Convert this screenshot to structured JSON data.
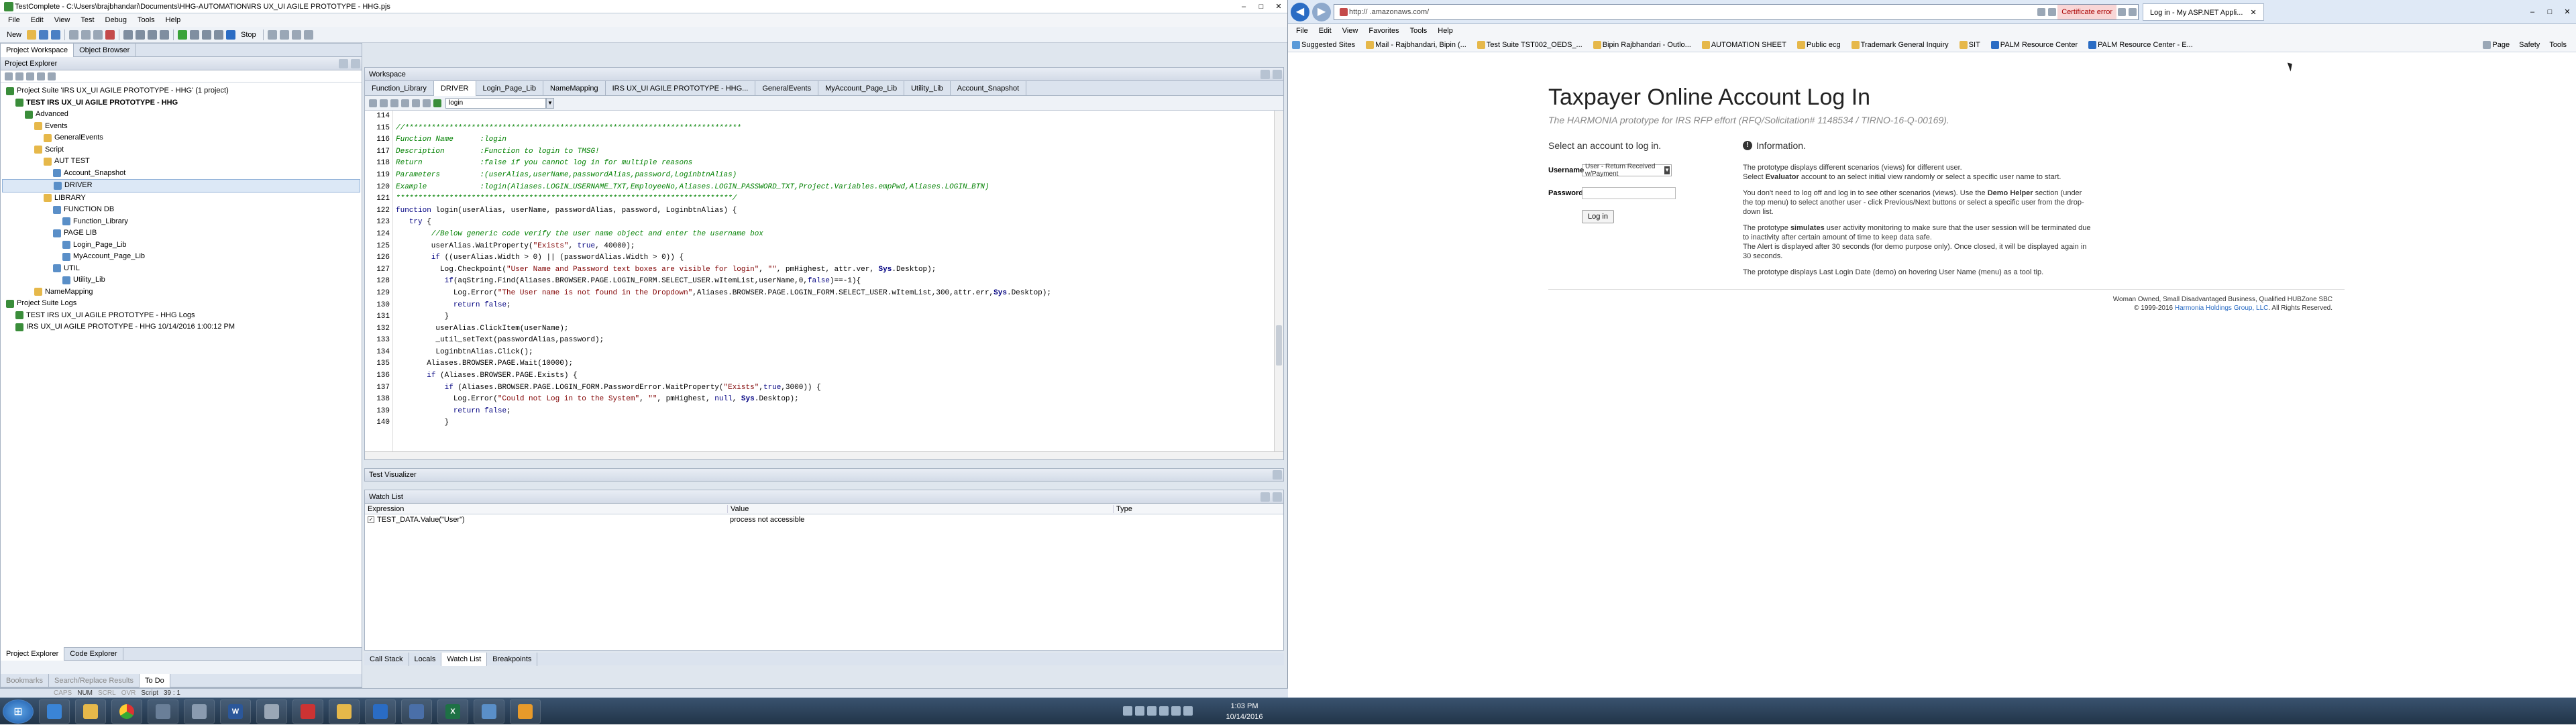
{
  "testcomplete": {
    "title": "TestComplete - C:\\Users\\brajbhandari\\Documents\\HHG-AUTOMATION\\IRS UX_UI AGILE PROTOTYPE - HHG.pjs",
    "menu": [
      "File",
      "Edit",
      "View",
      "Test",
      "Debug",
      "Tools",
      "Help"
    ],
    "toolbar_new": "New",
    "toolbar_stop": "Stop",
    "project_tabs": [
      "Project Workspace",
      "Object Browser"
    ],
    "project_explorer_title": "Project Explorer",
    "tree": [
      {
        "label": "Project Suite 'IRS UX_UI AGILE PROTOTYPE - HHG' (1 project)",
        "indent": 0,
        "bold": false
      },
      {
        "label": "TEST IRS UX_UI AGILE PROTOTYPE - HHG",
        "indent": 1,
        "bold": true
      },
      {
        "label": "Advanced",
        "indent": 2,
        "bold": false
      },
      {
        "label": "Events",
        "indent": 3,
        "bold": false
      },
      {
        "label": "GeneralEvents",
        "indent": 4,
        "bold": false
      },
      {
        "label": "Script",
        "indent": 3,
        "bold": false
      },
      {
        "label": "AUT TEST",
        "indent": 4,
        "bold": false
      },
      {
        "label": "Account_Snapshot",
        "indent": 5,
        "bold": false
      },
      {
        "label": "DRIVER",
        "indent": 5,
        "bold": false,
        "selected": true
      },
      {
        "label": "LIBRARY",
        "indent": 4,
        "bold": false
      },
      {
        "label": "FUNCTION DB",
        "indent": 5,
        "bold": false
      },
      {
        "label": "Function_Library",
        "indent": 6,
        "bold": false
      },
      {
        "label": "PAGE LIB",
        "indent": 5,
        "bold": false
      },
      {
        "label": "Login_Page_Lib",
        "indent": 6,
        "bold": false
      },
      {
        "label": "MyAccount_Page_Lib",
        "indent": 6,
        "bold": false
      },
      {
        "label": "UTIL",
        "indent": 5,
        "bold": false
      },
      {
        "label": "Utility_Lib",
        "indent": 6,
        "bold": false
      },
      {
        "label": "NameMapping",
        "indent": 3,
        "bold": false
      },
      {
        "label": "Project Suite Logs",
        "indent": 0,
        "bold": false
      },
      {
        "label": "TEST IRS UX_UI AGILE PROTOTYPE - HHG Logs",
        "indent": 1,
        "bold": false
      },
      {
        "label": "IRS UX_UI AGILE PROTOTYPE - HHG 10/14/2016 1:00:12 PM",
        "indent": 1,
        "bold": false
      }
    ],
    "project_bottom_tabs": [
      "Project Explorer",
      "Code Explorer"
    ],
    "todo_tabs": [
      "Bookmarks",
      "Search/Replace Results",
      "To Do"
    ],
    "workspace_title": "Workspace",
    "doc_tabs": [
      "Function_Library",
      "DRIVER",
      "Login_Page_Lib",
      "NameMapping",
      "IRS UX_UI AGILE PROTOTYPE - HHG...",
      "GeneralEvents",
      "MyAccount_Page_Lib",
      "Utility_Lib",
      "Account_Snapshot"
    ],
    "active_doc_tab": "DRIVER",
    "routine_selector": "login",
    "code_lines": [
      {
        "n": "114",
        "html": ""
      },
      {
        "n": "115",
        "html": "<span class='c'>//****************************************************************************</span>"
      },
      {
        "n": "116",
        "html": "<span class='c'>Function Name      :login</span>"
      },
      {
        "n": "117",
        "html": "<span class='c'>Description        :Function to login to TMSG!</span>"
      },
      {
        "n": "118",
        "html": "<span class='c'>Return             :false if you cannot log in for multiple reasons</span>"
      },
      {
        "n": "119",
        "html": "<span class='c'>Parameters         :(userAlias,userName,passwordAlias,password,LoginbtnAlias)</span>"
      },
      {
        "n": "120",
        "html": "<span class='c'>Example            :login(Aliases.LOGIN_USERNAME_TXT,EmployeeNo,Aliases.LOGIN_PASSWORD_TXT,Project.Variables.empPwd,Aliases.LOGIN_BTN)</span>"
      },
      {
        "n": "121",
        "html": "<span class='c'>****************************************************************************/</span>"
      },
      {
        "n": "122",
        "html": "<span class='k'>function</span> login(userAlias, userName, passwordAlias, password, LoginbtnAlias) {"
      },
      {
        "n": "123",
        "html": "   <span class='k'>try</span> {"
      },
      {
        "n": "124",
        "html": "        <span class='c'>//Below generic code verify the user name object and enter the username box</span>"
      },
      {
        "n": "125",
        "html": "        userAlias.WaitProperty(<span class='s'>\"Exists\"</span>, <span class='k'>true</span>, 40000);"
      },
      {
        "n": "126",
        "html": "        <span class='k'>if</span> ((userAlias.Width > 0) || (passwordAlias.Width > 0)) {"
      },
      {
        "n": "127",
        "html": "          Log.Checkpoint(<span class='s'>\"User Name and Password text boxes are visible for login\"</span>, <span class='s'>\"\"</span>, pmHighest, attr.ver, <span class='b'>Sys</span>.Desktop);"
      },
      {
        "n": "128",
        "html": "           <span class='k'>if</span>(aqString.Find(Aliases.BROWSER.PAGE.LOGIN_FORM.SELECT_USER.wItemList,userName,0,<span class='k'>false</span>)==-1){"
      },
      {
        "n": "129",
        "html": "             Log.Error(<span class='s'>\"The User name is not found in the Dropdown\"</span>,Aliases.BROWSER.PAGE.LOGIN_FORM.SELECT_USER.wItemList,300,attr.err,<span class='b'>Sys</span>.Desktop);"
      },
      {
        "n": "130",
        "html": "             <span class='k'>return false</span>;"
      },
      {
        "n": "131",
        "html": "           }"
      },
      {
        "n": "132",
        "html": "         userAlias.ClickItem(userName);"
      },
      {
        "n": "133",
        "html": "         _util_setText(passwordAlias,password);"
      },
      {
        "n": "134",
        "html": "         LoginbtnAlias.Click();"
      },
      {
        "n": "135",
        "html": "       Aliases.BROWSER.PAGE.Wait(10000);"
      },
      {
        "n": "136",
        "html": "       <span class='k'>if</span> (Aliases.BROWSER.PAGE.Exists) {"
      },
      {
        "n": "137",
        "html": "           <span class='k'>if</span> (Aliases.BROWSER.PAGE.LOGIN_FORM.PasswordError.WaitProperty(<span class='s'>\"Exists\"</span>,<span class='k'>true</span>,3000)) {"
      },
      {
        "n": "138",
        "html": "             Log.Error(<span class='s'>\"Could not Log in to the System\"</span>, <span class='s'>\"\"</span>, pmHighest, <span class='k'>null</span>, <span class='b'>Sys</span>.Desktop);"
      },
      {
        "n": "139",
        "html": "             <span class='k'>return false</span>;"
      },
      {
        "n": "140",
        "html": "           }"
      }
    ],
    "test_visualizer": "Test Visualizer",
    "watch_title": "Watch List",
    "watch_cols": [
      "Expression",
      "Value",
      "Type"
    ],
    "watch_row": {
      "expr": "TEST_DATA.Value(\"User\")",
      "value": "process not accessible",
      "type": ""
    },
    "bottom_tabs": [
      "Call Stack",
      "Locals",
      "Watch List",
      "Breakpoints"
    ],
    "status": [
      "CAPS",
      "NUM",
      "SCRL",
      "OVR",
      "Script",
      "39 : 1"
    ]
  },
  "ie": {
    "address": "http://                        .amazonaws.com/",
    "cert_error": "Certificate error",
    "tab_title": "Log in - My ASP.NET Appli...",
    "menu": [
      "File",
      "Edit",
      "View",
      "Favorites",
      "Tools",
      "Help"
    ],
    "favorites": [
      "Suggested Sites",
      "Mail - Rajbhandari, Bipin (...",
      "Test Suite TST002_OEDS_...",
      "Bipin Rajbhandari - Outlo...",
      "AUTOMATION SHEET",
      "Public ecg",
      "Trademark General Inquiry",
      "SIT",
      "PALM Resource Center",
      "PALM Resource Center - E..."
    ],
    "cmd": [
      "Page",
      "Safety",
      "Tools"
    ]
  },
  "page": {
    "title": "Taxpayer Online Account Log In",
    "subtitle": "The HARMONIA prototype for IRS RFP effort (RFQ/Solicitation# 1148534 / TIRNO-16-Q-00169).",
    "select_heading": "Select an account to log in.",
    "username_label": "Username",
    "username_value": "User - Return Received w/Payment",
    "password_label": "Password",
    "login_button": "Log in",
    "info_heading": "Information.",
    "info": [
      "The prototype displays different scenarios (views) for different user.\nSelect Evaluator account to an select initial view randomly or select a specific user name to start.",
      "You don't need to log off and log in to see other scenarios (views). Use the Demo Helper section (under the top menu) to select another user - click Previous/Next buttons or select a specific user from the drop-down list.",
      "The prototype simulates user activity monitoring to make sure that the user session will be terminated due to inactivity after certain amount of time to keep data safe.\nThe Alert is displayed after 30 seconds (for demo purpose only). Once closed, it will be displayed again in 30 seconds.",
      "The prototype displays Last Login Date (demo) on hovering User Name (menu) as a tool tip."
    ],
    "footer1": "Woman Owned, Small Disadvantaged Business, Qualified HUBZone SBC",
    "footer2a": "© 1999-2016 ",
    "footer2_link": "Harmonia Holdings Group, LLC",
    "footer2b": ". All Rights Reserved."
  },
  "taskbar": {
    "time": "1:03 PM",
    "date": "10/14/2016",
    "apps": [
      "start",
      "ie",
      "explorer",
      "chrome",
      "calculator",
      "misc",
      "word",
      "files",
      "pdf",
      "outlook",
      "terminal",
      "remote",
      "excel",
      "testcomplete",
      "other"
    ]
  },
  "colors": {
    "accent": "#2a6cc4",
    "bg": "#dfe6ee"
  }
}
